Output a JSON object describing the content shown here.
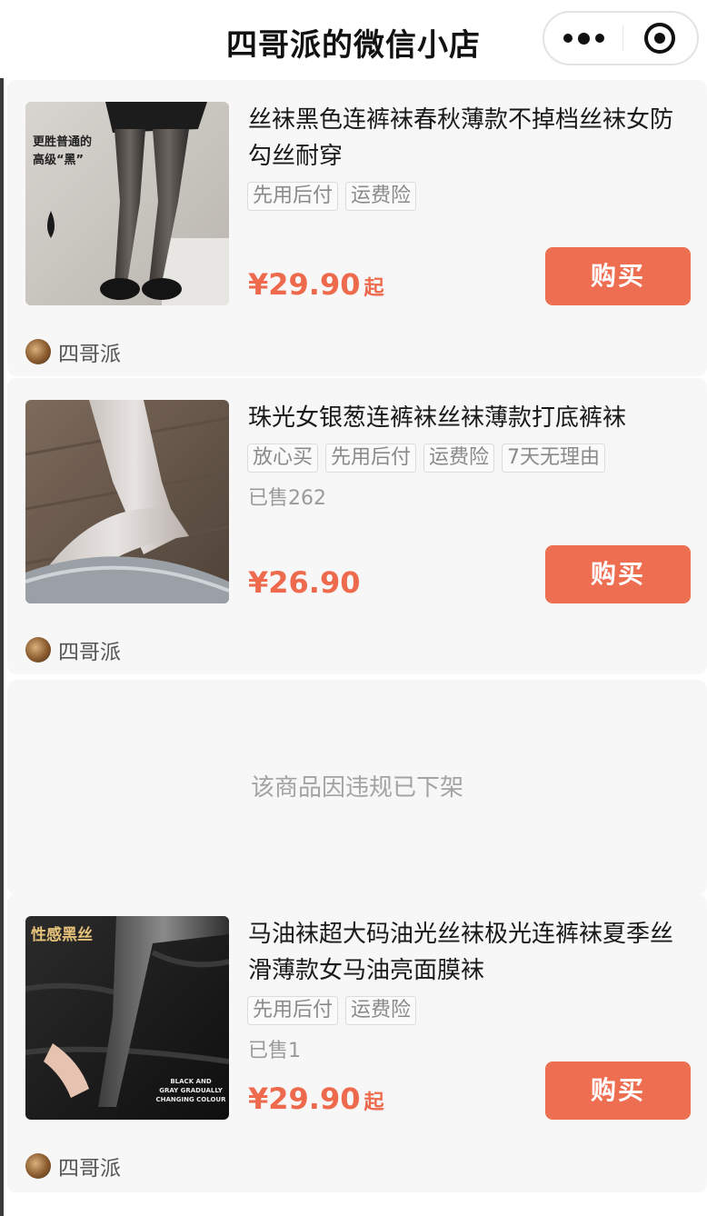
{
  "header": {
    "title": "四哥派的微信小店",
    "more_icon": "more-dots-icon",
    "close_icon": "target-close-icon"
  },
  "products": [
    {
      "title": "丝袜黑色连裤袜春秋薄款不掉档丝袜女防勾丝耐穿",
      "tags": [
        "先用后付",
        "运费险"
      ],
      "sold": "",
      "price": "¥29.90",
      "price_suffix": "起",
      "buy_label": "购买",
      "shop_name": "四哥派",
      "image_text": [
        "更胜普通的",
        "高级“黑”"
      ]
    },
    {
      "title": "珠光女银葱连裤袜丝袜薄款打底裤袜",
      "tags": [
        "放心买",
        "先用后付",
        "运费险",
        "7天无理由"
      ],
      "sold": "已售262",
      "price": "¥26.90",
      "price_suffix": "",
      "buy_label": "购买",
      "shop_name": "四哥派"
    },
    {
      "title": "马油袜超大码油光丝袜极光连裤袜夏季丝滑薄款女马油亮面膜袜",
      "tags": [
        "先用后付",
        "运费险"
      ],
      "sold": "已售1",
      "price": "¥29.90",
      "price_suffix": "起",
      "buy_label": "购买",
      "shop_name": "四哥派",
      "image_text": [
        "性感黑丝",
        "BLACK AND",
        "GRAY GRADUALLY",
        "CHANGING COLOUR"
      ]
    }
  ],
  "removed_notice": "该商品因违规已下架",
  "colors": {
    "accent": "#ee6e51",
    "price": "#ee6a4c",
    "card_bg": "#f7f7f7"
  }
}
